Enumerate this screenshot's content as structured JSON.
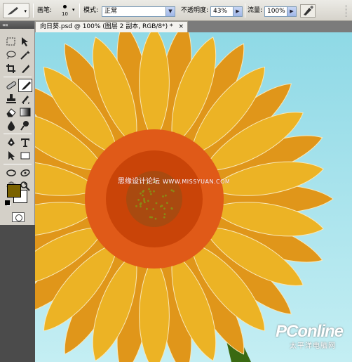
{
  "options_bar": {
    "brush_label": "画笔:",
    "brush_size": "10",
    "mode_label": "模式:",
    "mode_value": "正常",
    "opacity_label": "不透明度:",
    "opacity_value": "43%",
    "flow_label": "流量:",
    "flow_value": "100%"
  },
  "toolbox": {
    "collapse_label": "««",
    "foreground_color": "#7a6200",
    "background_color": "#ffffff"
  },
  "document": {
    "tab_title": "向日葵.psd @ 100% (图层 2 副本, RGB/8*) *",
    "close_label": "×"
  },
  "canvas": {
    "watermark_cn": "思缘设计论坛",
    "watermark_url": "WWW.MISSYUAN.COM",
    "logo_brand": "PConline",
    "logo_sub": "太平洋电脑网",
    "sky_color": "#a6e2ec",
    "petal_color": "#ecb325",
    "center_color": "#e05a18",
    "stem_color": "#3a6a12"
  }
}
